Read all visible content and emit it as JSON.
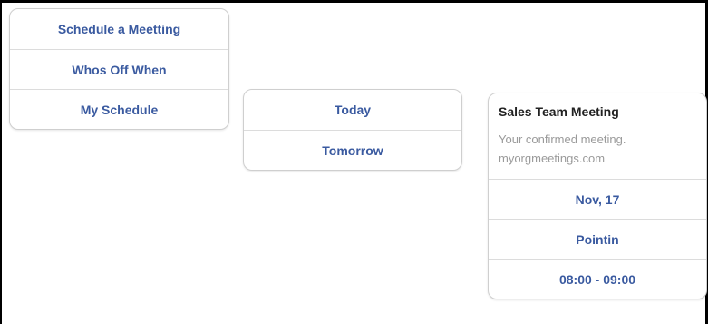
{
  "menu": {
    "items": [
      {
        "label": "Schedule a Meetting"
      },
      {
        "label": "Whos Off When"
      },
      {
        "label": "My Schedule"
      }
    ]
  },
  "days": {
    "items": [
      {
        "label": "Today"
      },
      {
        "label": "Tomorrow"
      }
    ]
  },
  "meeting": {
    "title": "Sales Team Meeting",
    "description_line1": "Your confirmed meeting.",
    "description_line2": "myorgmeetings.com",
    "date": "Nov, 17",
    "location": "Pointin",
    "time": "08:00 - 09:00"
  },
  "colors": {
    "link": "#3a5aa0",
    "muted": "#9a9a9a"
  }
}
